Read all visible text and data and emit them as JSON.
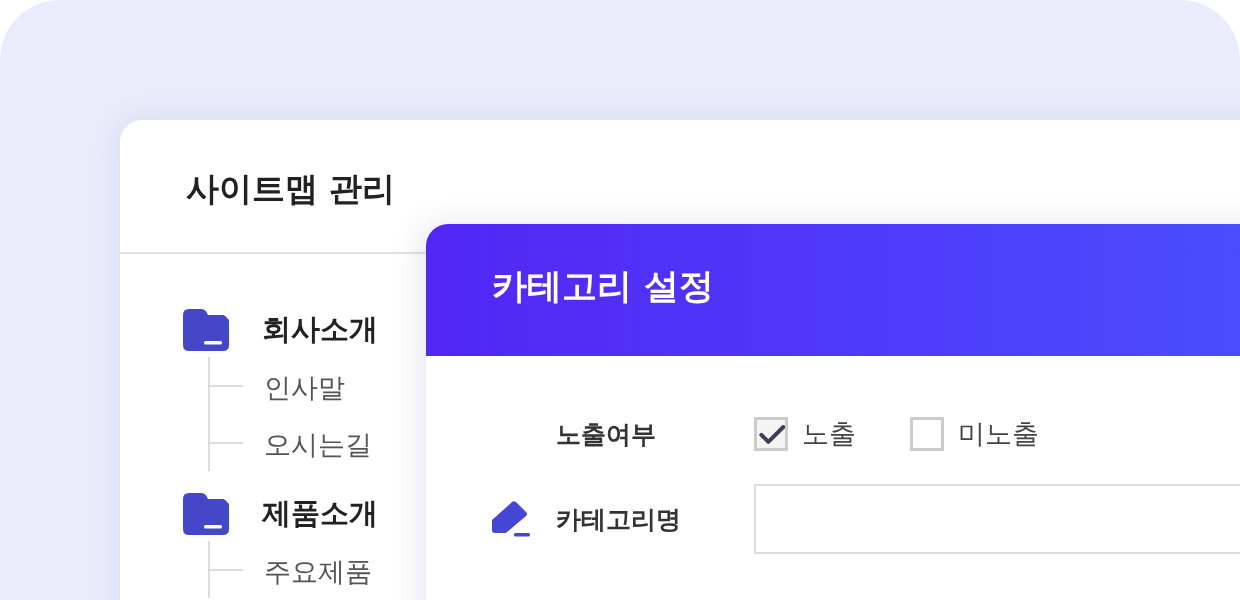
{
  "sitemap": {
    "title": "사이트맵 관리",
    "tree": [
      {
        "label": "회사소개",
        "children": [
          {
            "label": "인사말"
          },
          {
            "label": "오시는길"
          }
        ]
      },
      {
        "label": "제품소개",
        "children": [
          {
            "label": "주요제품"
          }
        ]
      }
    ]
  },
  "dialog": {
    "title": "카테고리 설정",
    "visibility": {
      "label": "노출여부",
      "options": [
        {
          "label": "노출",
          "checked": true
        },
        {
          "label": "미노출",
          "checked": false
        }
      ]
    },
    "name_field": {
      "label": "카테고리명"
    }
  }
}
